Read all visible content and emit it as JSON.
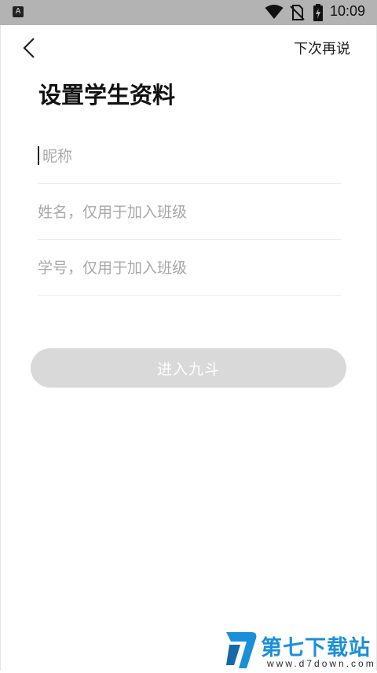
{
  "status_bar": {
    "notification_icon_letter": "A",
    "time": "10:09",
    "icons": [
      "wifi-icon",
      "no-sim-icon",
      "battery-charging-icon"
    ]
  },
  "header": {
    "back_icon": "chevron-left-icon",
    "skip_label": "下次再说"
  },
  "form": {
    "title": "设置学生资料",
    "nickname": {
      "value": "",
      "placeholder": "昵称"
    },
    "name": {
      "value": "",
      "placeholder": "姓名，仅用于加入班级"
    },
    "student_id": {
      "value": "",
      "placeholder": "学号，仅用于加入班级"
    },
    "submit_label": "进入九斗",
    "submit_enabled": false
  },
  "watermark": {
    "name": "第七下载站",
    "url": "www.d7down.com"
  },
  "colors": {
    "status_bar": "#b3b3b3",
    "button_disabled": "#d9d9d9",
    "placeholder": "#a8a8a8",
    "watermark_blue": "#1c8fd9"
  }
}
